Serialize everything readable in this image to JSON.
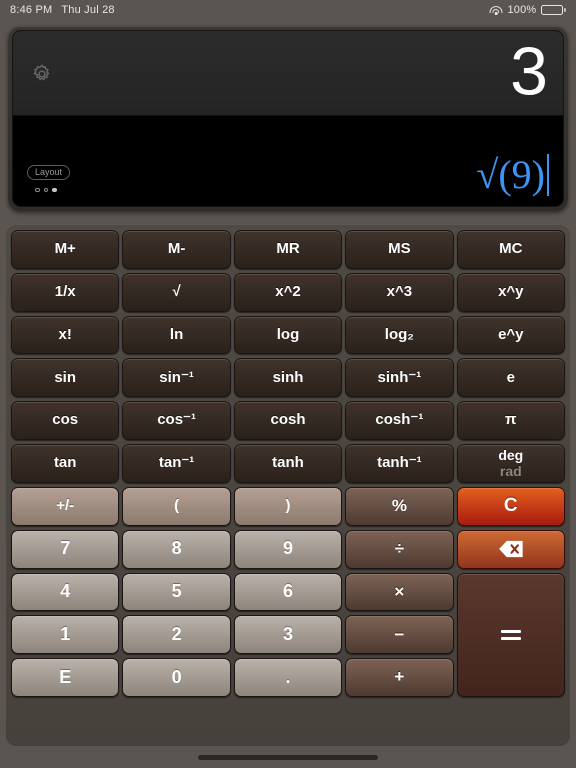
{
  "statusbar": {
    "time": "8:46 PM",
    "date": "Thu Jul 28",
    "battery_percent": "100%",
    "wifi_icon": "wifi-icon",
    "battery_icon": "battery-icon"
  },
  "display": {
    "settings_icon": "gear-icon",
    "result": "3",
    "expression_root": "√",
    "expression_arg": "(9)",
    "layout_chip": "Layout",
    "page_dots": 3,
    "active_dot": 3,
    "result_color": "#ffffff",
    "expression_color": "#3c95f5"
  },
  "keypad": {
    "rows": [
      [
        {
          "label": "M+",
          "style": "k-fn",
          "name": "key-memory-add"
        },
        {
          "label": "M-",
          "style": "k-fn",
          "name": "key-memory-subtract"
        },
        {
          "label": "MR",
          "style": "k-fn",
          "name": "key-memory-recall"
        },
        {
          "label": "MS",
          "style": "k-fn",
          "name": "key-memory-store"
        },
        {
          "label": "MC",
          "style": "k-fn",
          "name": "key-memory-clear"
        }
      ],
      [
        {
          "label": "1/x",
          "style": "k-fn",
          "name": "key-reciprocal"
        },
        {
          "label": "√",
          "style": "k-fn",
          "name": "key-square-root"
        },
        {
          "label": "x^2",
          "style": "k-fn",
          "name": "key-square"
        },
        {
          "label": "x^3",
          "style": "k-fn",
          "name": "key-cube"
        },
        {
          "label": "x^y",
          "style": "k-fn",
          "name": "key-power"
        }
      ],
      [
        {
          "label": "x!",
          "style": "k-fn",
          "name": "key-factorial"
        },
        {
          "label": "ln",
          "style": "k-fn",
          "name": "key-natural-log"
        },
        {
          "label": "log",
          "style": "k-fn",
          "name": "key-log"
        },
        {
          "label": "log₂",
          "style": "k-fn",
          "name": "key-log2"
        },
        {
          "label": "e^y",
          "style": "k-fn",
          "name": "key-exp"
        }
      ],
      [
        {
          "label": "sin",
          "style": "k-fn",
          "name": "key-sin"
        },
        {
          "label": "sin⁻¹",
          "style": "k-fn",
          "name": "key-asin"
        },
        {
          "label": "sinh",
          "style": "k-fn",
          "name": "key-sinh"
        },
        {
          "label": "sinh⁻¹",
          "style": "k-fn",
          "name": "key-asinh"
        },
        {
          "label": "e",
          "style": "k-fn",
          "name": "key-constant-e"
        }
      ],
      [
        {
          "label": "cos",
          "style": "k-fn",
          "name": "key-cos"
        },
        {
          "label": "cos⁻¹",
          "style": "k-fn",
          "name": "key-acos"
        },
        {
          "label": "cosh",
          "style": "k-fn",
          "name": "key-cosh"
        },
        {
          "label": "cosh⁻¹",
          "style": "k-fn",
          "name": "key-acosh"
        },
        {
          "label": "π",
          "style": "k-fn",
          "name": "key-constant-pi"
        }
      ],
      [
        {
          "label": "tan",
          "style": "k-fn",
          "name": "key-tan"
        },
        {
          "label": "tan⁻¹",
          "style": "k-fn",
          "name": "key-atan"
        },
        {
          "label": "tanh",
          "style": "k-fn",
          "name": "key-tanh"
        },
        {
          "label": "tanh⁻¹",
          "style": "k-fn",
          "name": "key-atanh"
        },
        {
          "label": "deg/rad",
          "style": "k-fn",
          "name": "key-angle-mode",
          "type": "angle-mode"
        }
      ],
      [
        {
          "label": "+/-",
          "style": "k-paren",
          "name": "key-sign-toggle"
        },
        {
          "label": "(",
          "style": "k-paren",
          "name": "key-open-paren"
        },
        {
          "label": ")",
          "style": "k-paren",
          "name": "key-close-paren"
        },
        {
          "label": "%",
          "style": "k-op",
          "name": "key-percent"
        },
        {
          "label": "C",
          "style": "k-clear",
          "name": "key-clear"
        }
      ],
      [
        {
          "label": "7",
          "style": "k-num",
          "name": "key-7"
        },
        {
          "label": "8",
          "style": "k-num",
          "name": "key-8"
        },
        {
          "label": "9",
          "style": "k-num",
          "name": "key-9"
        },
        {
          "label": "÷",
          "style": "k-op",
          "name": "key-divide"
        },
        {
          "label": "",
          "style": "k-back",
          "name": "key-backspace",
          "type": "backspace"
        }
      ],
      [
        {
          "label": "4",
          "style": "k-num",
          "name": "key-4"
        },
        {
          "label": "5",
          "style": "k-num",
          "name": "key-5"
        },
        {
          "label": "6",
          "style": "k-num",
          "name": "key-6"
        },
        {
          "label": "×",
          "style": "k-op",
          "name": "key-multiply"
        },
        {
          "label": "=",
          "style": "k-eq",
          "name": "key-equals",
          "type": "equals",
          "rowspan": 3
        }
      ],
      [
        {
          "label": "1",
          "style": "k-num",
          "name": "key-1"
        },
        {
          "label": "2",
          "style": "k-num",
          "name": "key-2"
        },
        {
          "label": "3",
          "style": "k-num",
          "name": "key-3"
        },
        {
          "label": "−",
          "style": "k-op",
          "name": "key-subtract"
        }
      ],
      [
        {
          "label": "E",
          "style": "k-num",
          "name": "key-exponent-e"
        },
        {
          "label": "0",
          "style": "k-num",
          "name": "key-0"
        },
        {
          "label": ".",
          "style": "k-num",
          "name": "key-decimal-point"
        },
        {
          "label": "+",
          "style": "k-op",
          "name": "key-add"
        }
      ]
    ],
    "angle_mode": {
      "active": "deg",
      "inactive": "rad"
    }
  }
}
